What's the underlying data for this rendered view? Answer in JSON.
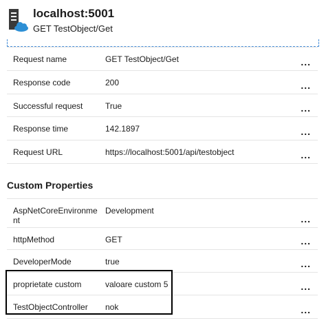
{
  "header": {
    "title": "localhost:5001",
    "subtitle": "GET TestObject/Get",
    "icon": "server-cloud-icon"
  },
  "details": [
    {
      "key": "Request name",
      "value": "GET TestObject/Get"
    },
    {
      "key": "Response code",
      "value": "200"
    },
    {
      "key": "Successful request",
      "value": "True"
    },
    {
      "key": "Response time",
      "value": "142.1897"
    },
    {
      "key": "Request URL",
      "value": "https://localhost:5001/api/testobject"
    }
  ],
  "custom_properties": {
    "title": "Custom Properties",
    "rows": [
      {
        "key": "AspNetCoreEnvironment",
        "value": "Development"
      },
      {
        "key": "httpMethod",
        "value": "GET"
      },
      {
        "key": "DeveloperMode",
        "value": "true"
      },
      {
        "key": "proprietate custom",
        "value": "valoare custom 5"
      },
      {
        "key": "TestObjectController",
        "value": "nok"
      }
    ]
  },
  "more_label": "...",
  "colors": {
    "selection_dash": "#4a90d9",
    "divider": "#e4e4e4",
    "highlight_border": "#000000"
  }
}
